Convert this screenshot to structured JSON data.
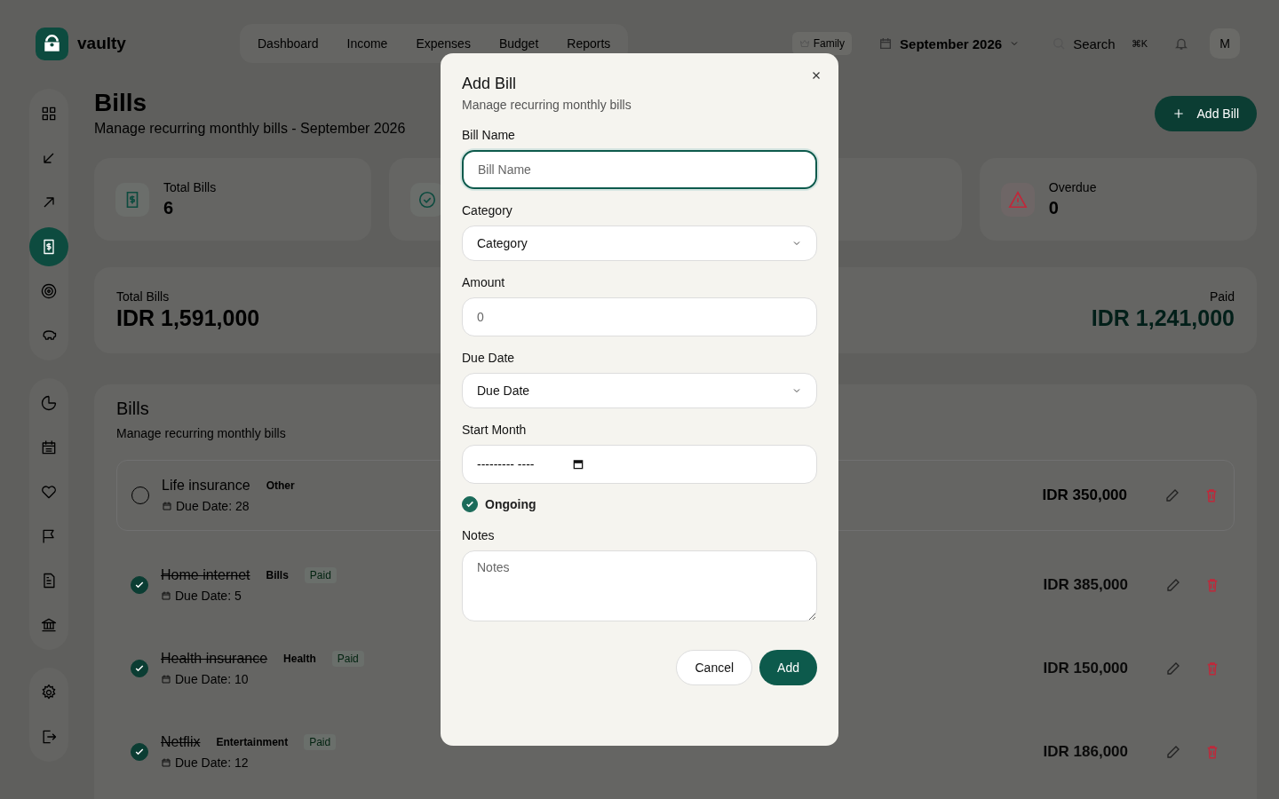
{
  "topbar": {
    "logo": "vaulty",
    "nav": [
      {
        "label": "Dashboard",
        "selected": false
      },
      {
        "label": "Income",
        "selected": false
      },
      {
        "label": "Expenses",
        "selected": false
      },
      {
        "label": "Budget",
        "selected": false
      },
      {
        "label": "Reports",
        "selected": false
      }
    ],
    "family": "Family",
    "month": "September 2026",
    "search": {
      "placeholder": "Search",
      "shortcut": "⌘K"
    },
    "avatar": "M"
  },
  "sidebar": {
    "groups": [
      [
        {
          "selected": false
        },
        {
          "selected": false
        },
        {
          "selected": false
        },
        {
          "selected": true
        },
        {
          "selected": false
        },
        {
          "selected": false
        }
      ],
      [
        {
          "selected": false
        },
        {
          "selected": false
        },
        {
          "selected": false
        },
        {
          "selected": false
        },
        {
          "selected": false
        },
        {
          "selected": false
        }
      ],
      [
        {
          "selected": false
        },
        {
          "selected": false
        }
      ]
    ]
  },
  "page": {
    "title": "Bills",
    "subtitle": "Manage recurring monthly bills - September 2026",
    "add_button": "Add Bill"
  },
  "stats": [
    {
      "kind": "total",
      "label": "Total Bills",
      "value": "6"
    },
    {
      "kind": "paid"
    },
    {
      "kind": "hidden"
    },
    {
      "kind": "overdue",
      "label": "Overdue",
      "value": "0"
    }
  ],
  "summary": {
    "left_label": "Total Bills",
    "left_value": "IDR 1,591,000",
    "right_label": "Paid",
    "right_value": "IDR 1,241,000"
  },
  "bills": {
    "title": "Bills",
    "subtitle": "Manage recurring monthly bills",
    "rows": [
      {
        "name": "Life insurance",
        "category": "Other",
        "paid": false,
        "due": "Due Date: 28",
        "amount": "IDR 350,000"
      },
      {
        "name": "Home internet",
        "category": "Bills",
        "paid": true,
        "badge": "Paid",
        "due": "Due Date: 5",
        "amount": "IDR 385,000"
      },
      {
        "name": "Health insurance",
        "category": "Health",
        "paid": true,
        "badge": "Paid",
        "due": "Due Date: 10",
        "amount": "IDR 150,000"
      },
      {
        "name": "Netflix",
        "category": "Entertainment",
        "paid": true,
        "badge": "Paid",
        "due": "Due Date: 12",
        "amount": "IDR 186,000"
      }
    ]
  },
  "modal": {
    "title": "Add Bill",
    "subtitle": "Manage recurring monthly bills",
    "fields": [
      {
        "kind": "text",
        "label": "Bill Name",
        "placeholder": "Bill Name",
        "focused": true
      },
      {
        "kind": "select",
        "label": "Category",
        "value": "Category",
        "focused": false
      },
      {
        "kind": "text",
        "label": "Amount",
        "placeholder": "0",
        "focused": false
      },
      {
        "kind": "select",
        "label": "Due Date",
        "value": "Due Date",
        "focused": false
      },
      {
        "kind": "month",
        "label": "Start Month",
        "value": "--------- ----",
        "focused": false
      },
      {
        "kind": "checkbox",
        "label": "Ongoing",
        "checked": true
      },
      {
        "kind": "textarea",
        "label": "Notes",
        "placeholder": "Notes",
        "focused": false
      }
    ],
    "cancel": "Cancel",
    "submit": "Add"
  }
}
